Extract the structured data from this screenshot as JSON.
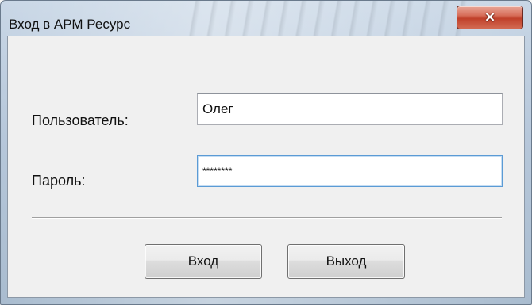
{
  "window": {
    "title": "Вход в АРМ Ресурс",
    "close_icon": "×"
  },
  "form": {
    "user_label": "Пользователь:",
    "user_value": "Олег",
    "password_label": "Пароль:",
    "password_value": "********"
  },
  "buttons": {
    "login_label": "Вход",
    "exit_label": "Выход"
  },
  "colors": {
    "close_button": "#c0402a",
    "focus_border": "#5b9bd5"
  }
}
